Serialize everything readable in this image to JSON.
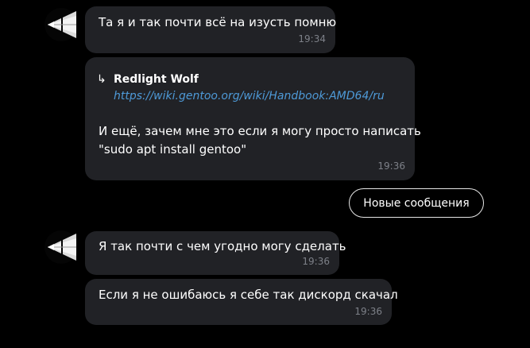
{
  "messages": [
    {
      "text": "Та я и так почти всё на изусть помню",
      "time": "19:34"
    },
    {
      "reply": {
        "arrow": "↳",
        "author": "Redlight Wolf",
        "link": "https://wiki.gentoo.org/wiki/Handbook:AMD64/ru"
      },
      "text_line1": "И ещё, зачем мне это если я могу просто написать",
      "text_line2": "\"sudo apt install gentoo\"",
      "time": "19:36"
    },
    {
      "text": "Я так почти с чем угодно могу сделать",
      "time": "19:36"
    },
    {
      "text": "Если я не ошибаюсь я себе так дискорд скачал",
      "time": "19:36"
    }
  ],
  "new_messages_button": {
    "label": "Новые сообщения"
  },
  "colors": {
    "background": "#000000",
    "bubble": "#212226",
    "timestamp": "#7d8088",
    "link": "#4e9ad8"
  }
}
